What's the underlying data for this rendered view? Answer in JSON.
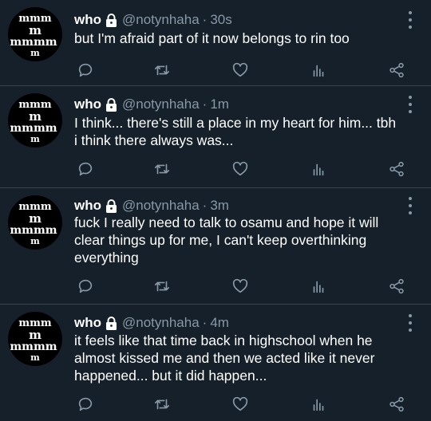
{
  "icons": {
    "reply": "reply-icon",
    "retweet": "retweet-icon",
    "like": "like-icon",
    "analytics": "analytics-icon",
    "share": "share-icon",
    "lock": "lock-icon",
    "more": "more-icon"
  },
  "colors": {
    "background": "#15202b",
    "text": "#ffffff",
    "secondary": "#8899a6",
    "divider": "#38444d"
  },
  "tweets": [
    {
      "name": "who",
      "handle": "@notynhaha",
      "separator": "·",
      "time": "30s",
      "lines": [
        "but I'm afraid part of it now belongs to rin too"
      ]
    },
    {
      "name": "who",
      "handle": "@notynhaha",
      "separator": "·",
      "time": "1m",
      "lines": [
        "I think... there's still a place in my heart for him... tbh",
        "i think there always was..."
      ]
    },
    {
      "name": "who",
      "handle": "@notynhaha",
      "separator": "·",
      "time": "3m",
      "lines": [
        "fuck I really need to talk to osamu and hope it will",
        "clear things up for me, I can't keep overthinking",
        "everything"
      ]
    },
    {
      "name": "who",
      "handle": "@notynhaha",
      "separator": "·",
      "time": "4m",
      "lines": [
        "it feels like that time back in highschool when he",
        "almost kissed me and then we acted like it never",
        "happened... but it did happen..."
      ]
    }
  ]
}
